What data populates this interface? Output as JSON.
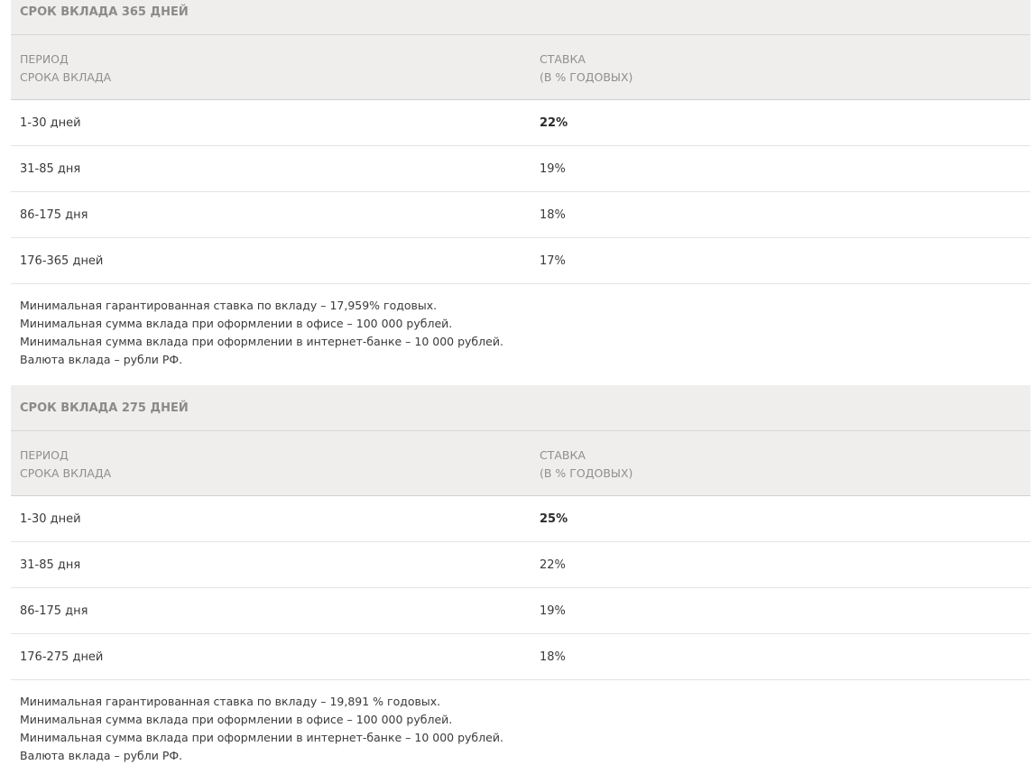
{
  "sections": [
    {
      "title": "СРОК ВКЛАДА 365 ДНЕЙ",
      "header": {
        "period_line1": "ПЕРИОД",
        "period_line2": "СРОКА ВКЛАДА",
        "rate_line1": "СТАВКА",
        "rate_line2": "(В % ГОДОВЫХ)"
      },
      "rows": [
        {
          "period": "1-30 дней",
          "rate": "22%"
        },
        {
          "period": "31-85 дня",
          "rate": "19%"
        },
        {
          "period": "86-175 дня",
          "rate": "18%"
        },
        {
          "period": "176-365 дней",
          "rate": "17%"
        }
      ],
      "notes": [
        "Минимальная гарантированная ставка по вкладу – 17,959% годовых.",
        "Минимальная сумма вклада при оформлении в офисе – 100 000 рублей.",
        "Минимальная сумма вклада при оформлении в интернет-банке – 10 000 рублей.",
        "Валюта вклада – рубли РФ."
      ]
    },
    {
      "title": "СРОК ВКЛАДА 275 ДНЕЙ",
      "header": {
        "period_line1": "ПЕРИОД",
        "period_line2": "СРОКА ВКЛАДА",
        "rate_line1": "СТАВКА",
        "rate_line2": "(В % ГОДОВЫХ)"
      },
      "rows": [
        {
          "period": "1-30 дней",
          "rate": "25%"
        },
        {
          "period": "31-85 дня",
          "rate": "22%"
        },
        {
          "period": "86-175 дня",
          "rate": "19%"
        },
        {
          "period": "176-275 дней",
          "rate": "18%"
        }
      ],
      "notes": [
        "Минимальная гарантированная ставка по вкладу – 19,891 % годовых.",
        "Минимальная сумма вклада при оформлении в офисе – 100 000 рублей.",
        "Минимальная сумма вклада при оформлении в интернет-банке – 10 000 рублей.",
        "Валюта вклада – рубли РФ."
      ]
    }
  ]
}
